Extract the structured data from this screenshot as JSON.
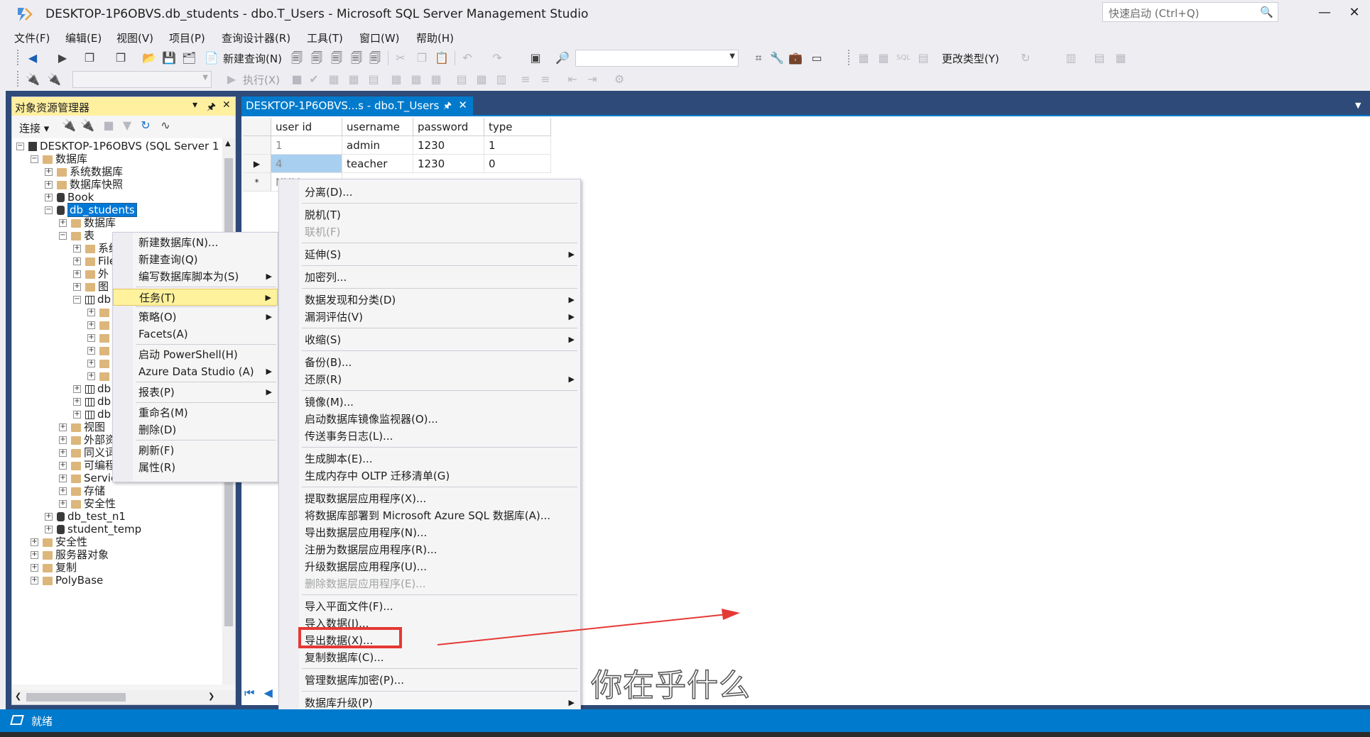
{
  "window": {
    "title": "DESKTOP-1P6OBVS.db_students - dbo.T_Users - Microsoft SQL Server Management Studio",
    "quick_launch_placeholder": "快速启动 (Ctrl+Q)"
  },
  "menubar": [
    "文件(F)",
    "编辑(E)",
    "视图(V)",
    "项目(P)",
    "查询设计器(R)",
    "工具(T)",
    "窗口(W)",
    "帮助(H)"
  ],
  "toolbar": {
    "new_query": "新建查询(N)",
    "change_type": "更改类型(Y)",
    "execute": "执行(X)"
  },
  "object_explorer": {
    "title": "对象资源管理器",
    "connect": "连接",
    "tree": [
      {
        "label": "DESKTOP-1P6OBVS (SQL Server 1"
      },
      {
        "label": "数据库"
      },
      {
        "label": "系统数据库"
      },
      {
        "label": "数据库快照"
      },
      {
        "label": "Book"
      },
      {
        "label": "db_students"
      },
      {
        "label": "数据库"
      },
      {
        "label": "表"
      },
      {
        "label": "系统"
      },
      {
        "label": "File"
      },
      {
        "label": "外"
      },
      {
        "label": "图"
      },
      {
        "label": "db"
      },
      {
        "label": "db"
      },
      {
        "label": "db"
      },
      {
        "label": "db"
      },
      {
        "label": "视图"
      },
      {
        "label": "外部资源"
      },
      {
        "label": "同义词"
      },
      {
        "label": "可编程性"
      },
      {
        "label": "Service Broker"
      },
      {
        "label": "存储"
      },
      {
        "label": "安全性"
      },
      {
        "label": "db_test_n1"
      },
      {
        "label": "student_temp"
      },
      {
        "label": "安全性"
      },
      {
        "label": "服务器对象"
      },
      {
        "label": "复制"
      },
      {
        "label": "PolyBase"
      }
    ]
  },
  "document": {
    "tab_title": "DESKTOP-1P6OBVS...s - dbo.T_Users",
    "columns": [
      "user id",
      "username",
      "password",
      "type"
    ],
    "rows": [
      [
        "1",
        "admin",
        "1230",
        "1"
      ],
      [
        "4",
        "teacher",
        "1230",
        "0"
      ]
    ],
    "new_row_text": "NULL"
  },
  "context_menu_1": [
    "新建数据库(N)...",
    "新建查询(Q)",
    "编写数据库脚本为(S)",
    "任务(T)",
    "策略(O)",
    "Facets(A)",
    "启动 PowerShell(H)",
    "Azure Data Studio (A)",
    "报表(P)",
    "重命名(M)",
    "删除(D)",
    "刷新(F)",
    "属性(R)"
  ],
  "context_menu_2": [
    "分离(D)...",
    "脱机(T)",
    "联机(F)",
    "延伸(S)",
    "加密列...",
    "数据发现和分类(D)",
    "漏洞评估(V)",
    "收缩(S)",
    "备份(B)...",
    "还原(R)",
    "镜像(M)...",
    "启动数据库镜像监视器(O)...",
    "传送事务日志(L)...",
    "生成脚本(E)...",
    "生成内存中 OLTP 迁移清单(G)",
    "提取数据层应用程序(X)...",
    "将数据库部署到 Microsoft Azure SQL 数据库(A)...",
    "导出数据层应用程序(N)...",
    "注册为数据层应用程序(R)...",
    "升级数据层应用程序(U)...",
    "删除数据层应用程序(E)...",
    "导入平面文件(F)...",
    "导入数据(I)...",
    "导出数据(X)...",
    "复制数据库(C)...",
    "管理数据库加密(P)...",
    "数据库升级(P)"
  ],
  "status": {
    "text": "就绪"
  },
  "watermark": "你在乎什么",
  "colors": {
    "accent": "#007acc",
    "highlight": "#e53935",
    "menu_hover": "#fff29d"
  }
}
